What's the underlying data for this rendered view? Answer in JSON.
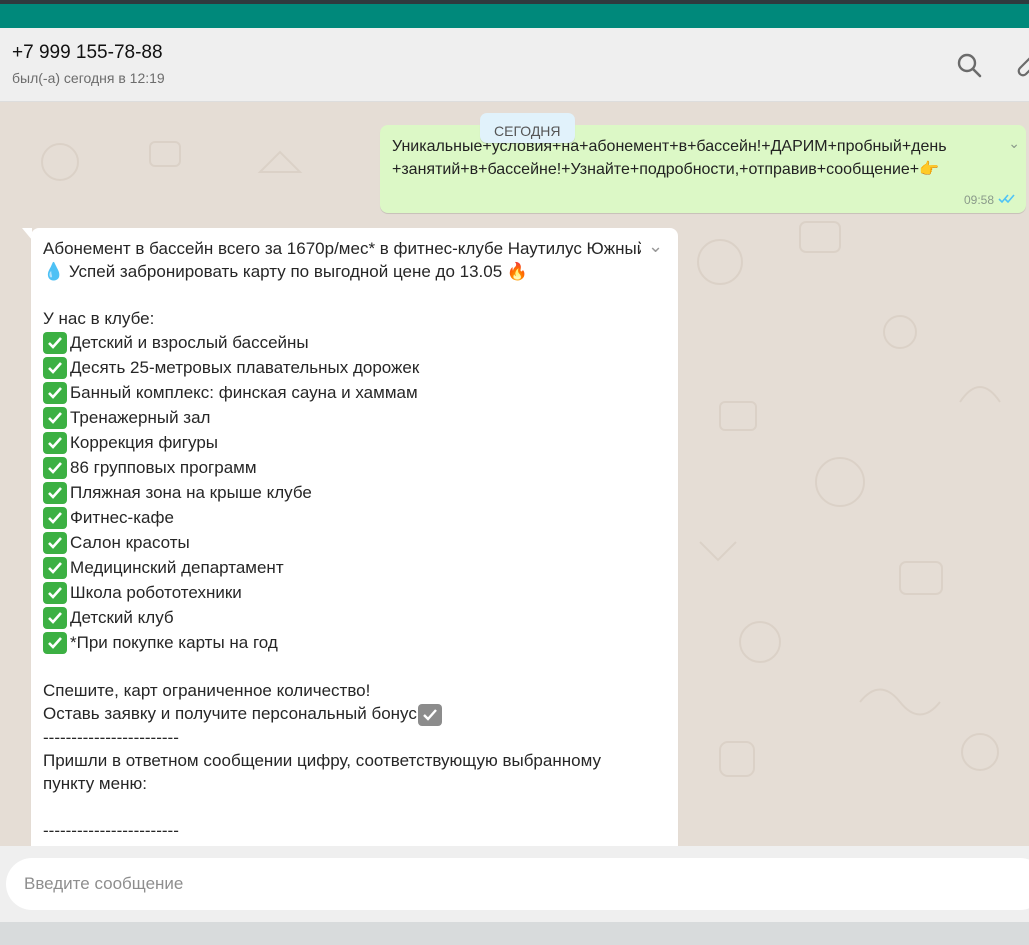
{
  "header": {
    "contact_name": "+7 999 155-78-88",
    "status": "был(-а) сегодня в 12:19",
    "search_icon": "search-icon",
    "attach_icon": "paperclip-icon"
  },
  "chat": {
    "date_chip": "СЕГОДНЯ",
    "outgoing": {
      "line1": "Уникальные+условия+на+абонемент+в+бассейн!+ДАРИМ+пробный+день",
      "line2": "+занятий+в+бассейне!+Узнайте+подробности,+отправив+сообщение+👉",
      "time": "09:58",
      "status_icon": "double-check-icon"
    },
    "incoming": {
      "line1": "Абонемент в бассейн всего за 1670р/мес* в фитнес-клубе Наутилус Южный",
      "line2": "💧 Успей забронировать карту по выгодной цене до 13.05 🔥",
      "club_heading": "У нас в клубе:",
      "features": [
        "Детский и взрослый бассейны",
        "Десять 25-метровых плавательных дорожек",
        "Банный комплекс: финская сауна и хаммам",
        "Тренажерный зал",
        "Коррекция фигуры",
        "86 групповых программ",
        "Пляжная зона на крыше клубе",
        "Фитнес-кафе",
        "Салон красоты",
        "Медицинский департамент",
        "Школа робототехники",
        "Детский клуб",
        "*При покупке карты на год"
      ],
      "hurry": "Спешите, карт ограниченное количество!",
      "bonus": "Оставь заявку и получите персональный бонус",
      "divider": "------------------------",
      "menu_text_1": "Пришли в ответном сообщении цифру, соответствующую выбранному",
      "menu_text_2": "пункту меню:",
      "divider2": "------------------------"
    }
  },
  "composer": {
    "placeholder": "Введите сообщение"
  },
  "colors": {
    "accent": "#00897b",
    "outgoing_bubble": "#dcf8c6",
    "check_green": "#3cb043"
  }
}
